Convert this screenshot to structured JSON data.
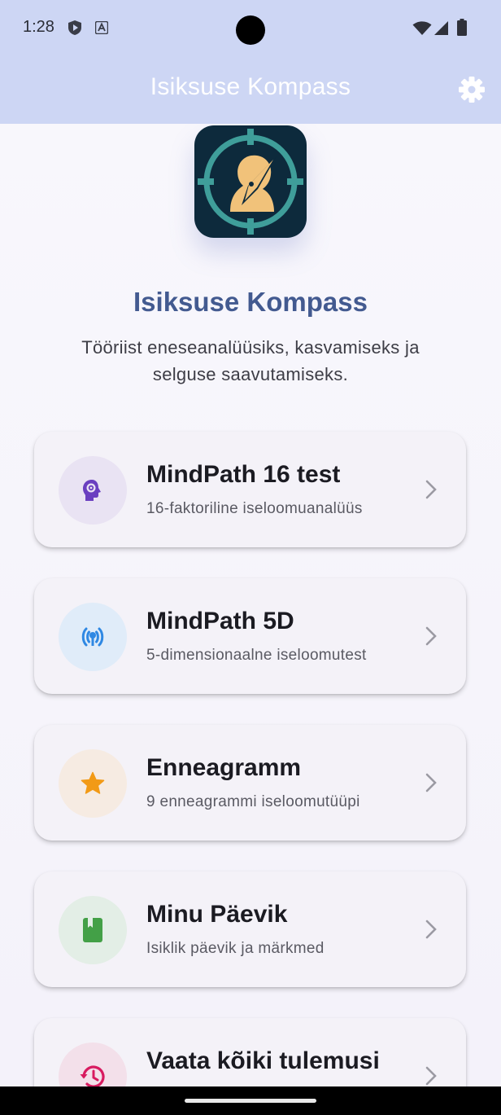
{
  "status_bar": {
    "time": "1:28",
    "left_icons": [
      "shield-icon",
      "font-a-icon"
    ],
    "right_icons": [
      "wifi-icon",
      "cell-signal-icon",
      "battery-icon"
    ]
  },
  "app_bar": {
    "title": "Isiksuse Kompass",
    "settings_icon": "gear-icon"
  },
  "hero": {
    "title": "Isiksuse Kompass",
    "subtitle": "Tööriist eneseanalüüsiks, kasvamiseks ja selguse saavutamiseks."
  },
  "cards": [
    {
      "title": "MindPath 16 test",
      "subtitle": "16-faktoriline iseloomuanalüüs",
      "icon": "psychology-head-icon",
      "icon_color": "#6a3fc0",
      "circle_color": "#e9e3f3"
    },
    {
      "title": "MindPath 5D",
      "subtitle": "5-dimensionaalne iseloomutest",
      "icon": "broadcast-signal-icon",
      "icon_color": "#2f88e3",
      "circle_color": "#e0ecf9"
    },
    {
      "title": "Enneagramm",
      "subtitle": "9 enneagrammi iseloomutüüpi",
      "icon": "star-icon",
      "icon_color": "#f29a16",
      "circle_color": "#f6ebe2"
    },
    {
      "title": "Minu Päevik",
      "subtitle": "Isiklik päevik ja märkmed",
      "icon": "book-icon",
      "icon_color": "#43a047",
      "circle_color": "#e3eee6"
    },
    {
      "title": "Vaata kõiki tulemusi",
      "subtitle": "",
      "icon": "history-icon",
      "icon_color": "#d81b60",
      "circle_color": "#f3e0ea"
    }
  ],
  "colors": {
    "app_bar": "#cdd6f4",
    "title_accent": "#435a90",
    "background": "#f6f4fb"
  }
}
